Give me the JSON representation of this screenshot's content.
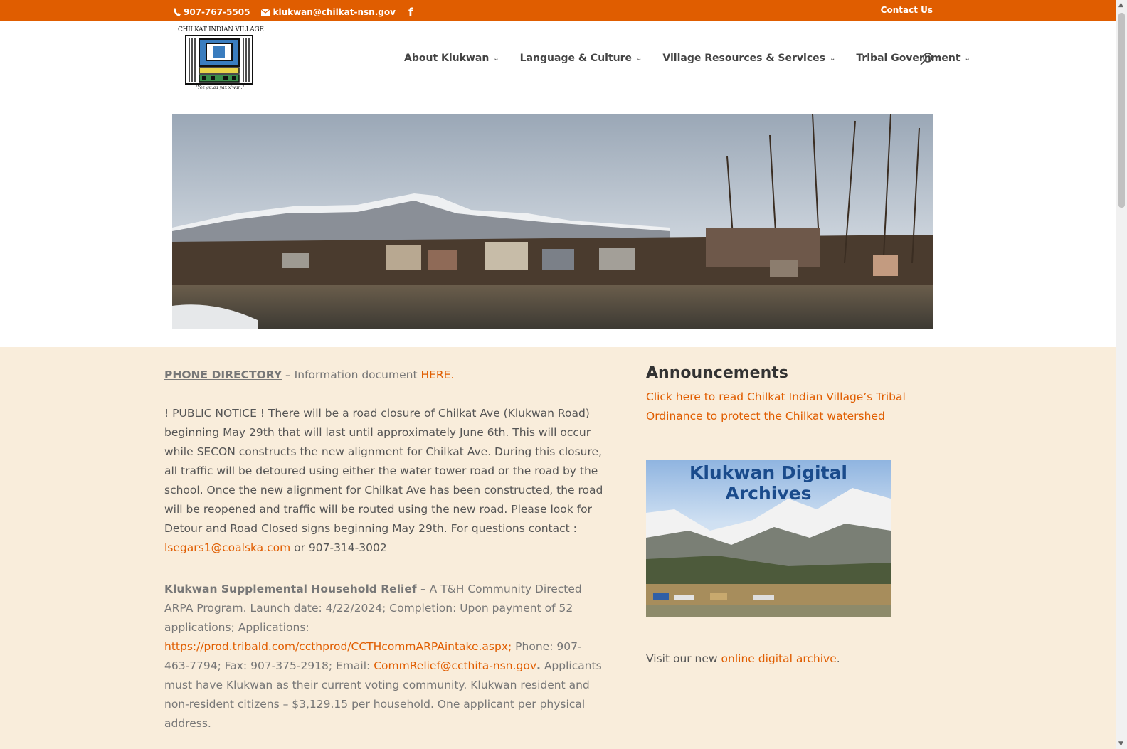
{
  "topbar": {
    "phone": "907-767-5505",
    "email": "klukwan@chilkat-nsn.gov",
    "facebook_glyph": "f",
    "contact_label": "Contact Us",
    "icons": [
      "phone-icon",
      "mail-icon",
      "facebook-icon"
    ],
    "color": "#e05d00"
  },
  "logo": {
    "title": "CHILKAT INDIAN VILLAGE",
    "motto": "\"Yee gu.aa yax x'wan.\""
  },
  "nav": {
    "items": [
      {
        "label": "About Klukwan"
      },
      {
        "label": "Language & Culture"
      },
      {
        "label": "Village Resources & Services"
      },
      {
        "label": "Tribal Government"
      }
    ],
    "search_icon": "search-icon"
  },
  "main": {
    "directory": {
      "label": "PHONE DIRECTORY",
      "sep": " – Information document ",
      "link": "HERE."
    },
    "notice": {
      "text": " ! PUBLIC NOTICE ! There will be a road closure of Chilkat Ave (Klukwan Road) beginning May 29th that will last until approximately June 6th. This will occur while SECON constructs the new alignment for Chilkat Ave. During this closure, all traffic will be detoured using either the water tower road or the road by the school. Once the new alignment for Chilkat Ave has been constructed, the road will be reopened and traffic will be routed using the new road. Please look for Detour and Road Closed signs beginning May 29th. For questions contact : ",
      "email": "lsegars1@coalska.com",
      "tail": " or 907-314-3002"
    },
    "relief": {
      "title": "Klukwan Supplemental Household Relief –",
      "text1": " A T&H Community Directed ARPA Program. Launch date: 4/22/2024; Completion: Upon payment of 52 applications; Applications: ",
      "link": "https://prod.tribald.com/ccthprod/CCTHcommARPAintake.aspx;",
      "text2": " Phone: 907-463-7794; Fax: 907-375-2918; Email: ",
      "email": "CommRelief@ccthita-nsn.gov",
      "dot": ".",
      "text3": " Applicants must have Klukwan as their current voting community. Klukwan resident and non-resident citizens – $3,129.15 per household. One applicant per physical address."
    }
  },
  "sidebar": {
    "title": "Announcements",
    "link": "Click here to read Chilkat Indian Village’s Tribal Ordinance to protect the Chilkat watershed",
    "archive_title": "Klukwan Digital Archives",
    "visit_pre": "Visit our new ",
    "visit_link": "online digital archive",
    "visit_post": "."
  },
  "colors": {
    "accent": "#e05d00",
    "band": "#f9eddb",
    "archive_title": "#1a4b8c"
  }
}
